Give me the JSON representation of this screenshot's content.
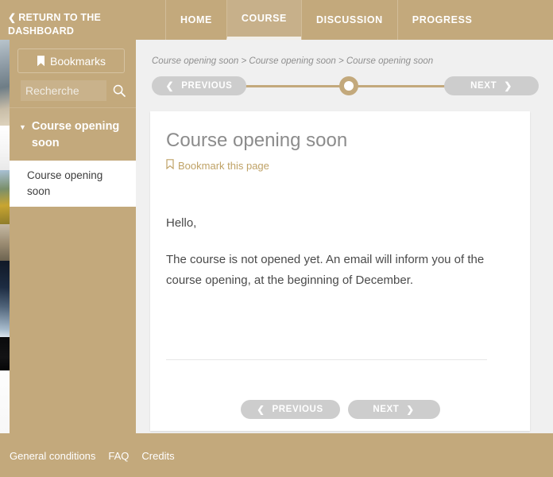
{
  "header": {
    "return_link": "RETURN TO THE DASHBOARD",
    "return_icon": "chevron-left-icon",
    "tabs": [
      {
        "label": "HOME",
        "active": false
      },
      {
        "label": "COURSE",
        "active": true
      },
      {
        "label": "DISCUSSION",
        "active": false
      },
      {
        "label": "PROGRESS",
        "active": false
      }
    ]
  },
  "sidebar": {
    "bookmarks_label": "Bookmarks",
    "bookmarks_icon": "bookmark-filled-icon",
    "search_placeholder": "Recherche",
    "search_value": "",
    "search_icon": "search-icon",
    "chapter": {
      "caret_icon": "caret-down-icon",
      "label": "Course opening soon"
    },
    "section": {
      "label": "Course opening soon"
    }
  },
  "content": {
    "breadcrumb": "Course opening soon > Course opening soon > Course opening soon",
    "sequence_nav": {
      "previous_label": "PREVIOUS",
      "next_label": "NEXT",
      "previous_icon": "chevron-left-icon",
      "next_icon": "chevron-right-icon",
      "marker_position_percent": 50
    },
    "page_title": "Course opening soon",
    "bookmark_link": "Bookmark this page",
    "bookmark_icon": "bookmark-outline-icon",
    "paragraphs": [
      "Hello,",
      "The course is not opened yet. An email will inform you of the course opening, at the beginning of December."
    ],
    "bottom_nav": {
      "previous_label": "PREVIOUS",
      "next_label": "NEXT",
      "previous_icon": "chevron-left-icon",
      "next_icon": "chevron-right-icon"
    }
  },
  "footer": {
    "links": [
      {
        "label": "General conditions"
      },
      {
        "label": "FAQ"
      },
      {
        "label": "Credits"
      }
    ]
  },
  "colors": {
    "brand": "#c3a97c",
    "brand_active_tab": "#c7b08a",
    "accent_link": "#bfa266",
    "pill_gray": "#cdcdcd",
    "content_bg": "#f0f0f0",
    "card_bg": "#ffffff"
  }
}
